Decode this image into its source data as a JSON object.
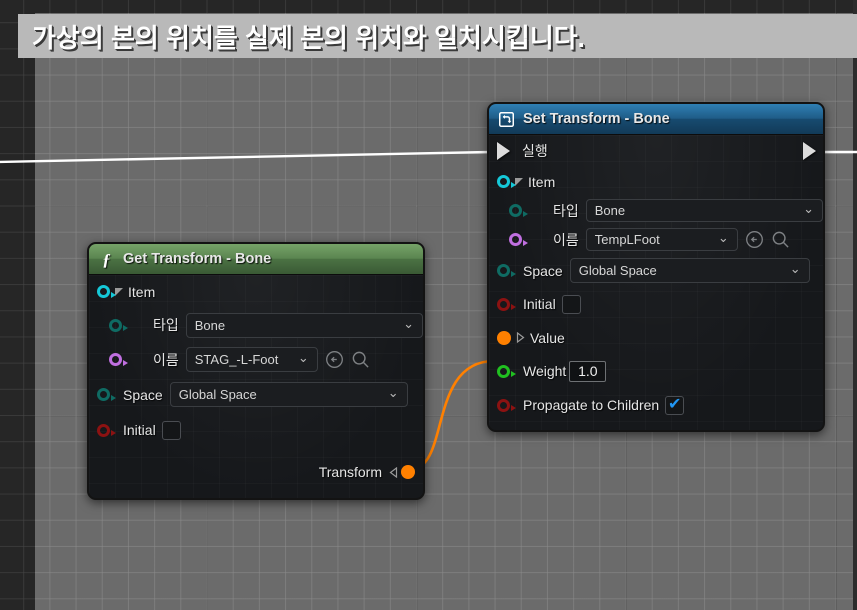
{
  "comment": {
    "text": "가상의 본의 위치를 실제 본의 위치와 일치시킵니다."
  },
  "colors": {
    "exec_wire": "#ffffff",
    "data_wire": "#ff8000",
    "set_node_header": "#1f5c87",
    "get_node_header": "#5a8550",
    "checkbox_check": "#2196f3",
    "pin_item": "#15c8d8",
    "pin_type": "#0f6b63",
    "pin_name": "#c06fe0",
    "pin_bool": "#8c1212",
    "pin_float": "#20c020",
    "pin_transform": "#ff8000"
  },
  "nodes": [
    {
      "id": "get-transform-bone",
      "title": "Get Transform - Bone",
      "icon": "function-icon",
      "header_style": "green",
      "rows": {
        "item_label": "Item",
        "type_label": "타입",
        "type_value": "Bone",
        "name_label": "이름",
        "name_value": "STAG_-L-Foot",
        "space_label": "Space",
        "space_value": "Global Space",
        "initial_label": "Initial",
        "initial_checked": "",
        "output_label": "Transform"
      }
    },
    {
      "id": "set-transform-bone",
      "title": "Set Transform - Bone",
      "icon": "transform-icon",
      "header_style": "blue",
      "rows": {
        "exec_label": "실행",
        "item_label": "Item",
        "type_label": "타입",
        "type_value": "Bone",
        "name_label": "이름",
        "name_value": "TempLFoot",
        "space_label": "Space",
        "space_value": "Global Space",
        "initial_label": "Initial",
        "initial_checked": "",
        "value_label": "Value",
        "weight_label": "Weight",
        "weight_value": "1.0",
        "propagate_label": "Propagate to Children",
        "propagate_checked": "✔"
      }
    }
  ]
}
